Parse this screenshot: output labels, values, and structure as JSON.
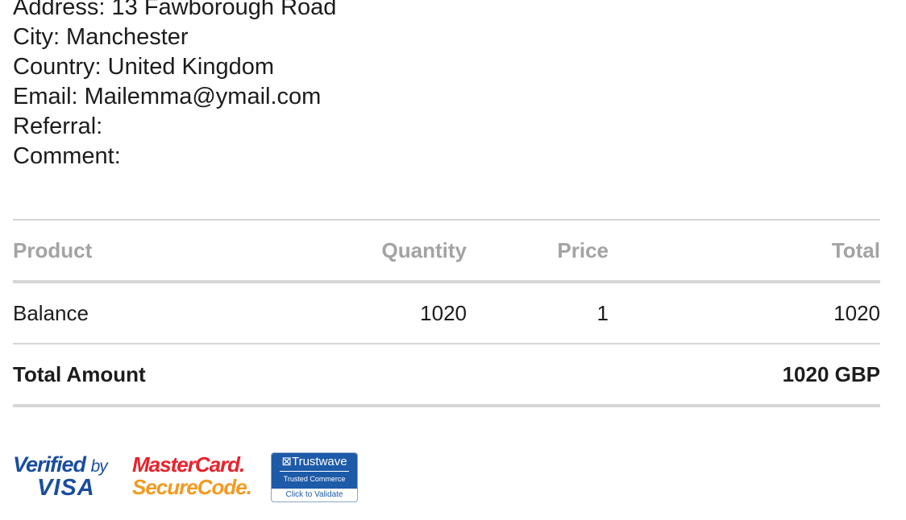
{
  "address": {
    "lines": [
      "Address: 13 Fawborough Road",
      "City: Manchester",
      "Country: United Kingdom",
      "Email: Mailemma@ymail.com",
      "Referral:",
      "Comment:"
    ]
  },
  "table": {
    "headers": {
      "product": "Product",
      "quantity": "Quantity",
      "price": "Price",
      "total": "Total"
    },
    "rows": [
      {
        "product": "Balance",
        "quantity": "1020",
        "price": "1",
        "total": "1020"
      }
    ],
    "total_label": "Total Amount",
    "total_value": "1020 GBP"
  },
  "badges": {
    "vbv": {
      "line1": "Verified",
      "by": "by",
      "line2": "VISA"
    },
    "mastercard": {
      "line1": "MasterCard.",
      "line2": "SecureCode."
    },
    "trustwave": {
      "brand": "Trustwave",
      "sub": "Trusted Commerce",
      "action": "Click to Validate"
    }
  },
  "colors": {
    "header_text": "#a3a3a3",
    "rule": "#d6d6d6",
    "visa_blue": "#1a4e9c",
    "mastercard_red": "#e8222c",
    "mastercard_orange": "#f29a1f",
    "trustwave_blue": "#1d5aa8"
  }
}
